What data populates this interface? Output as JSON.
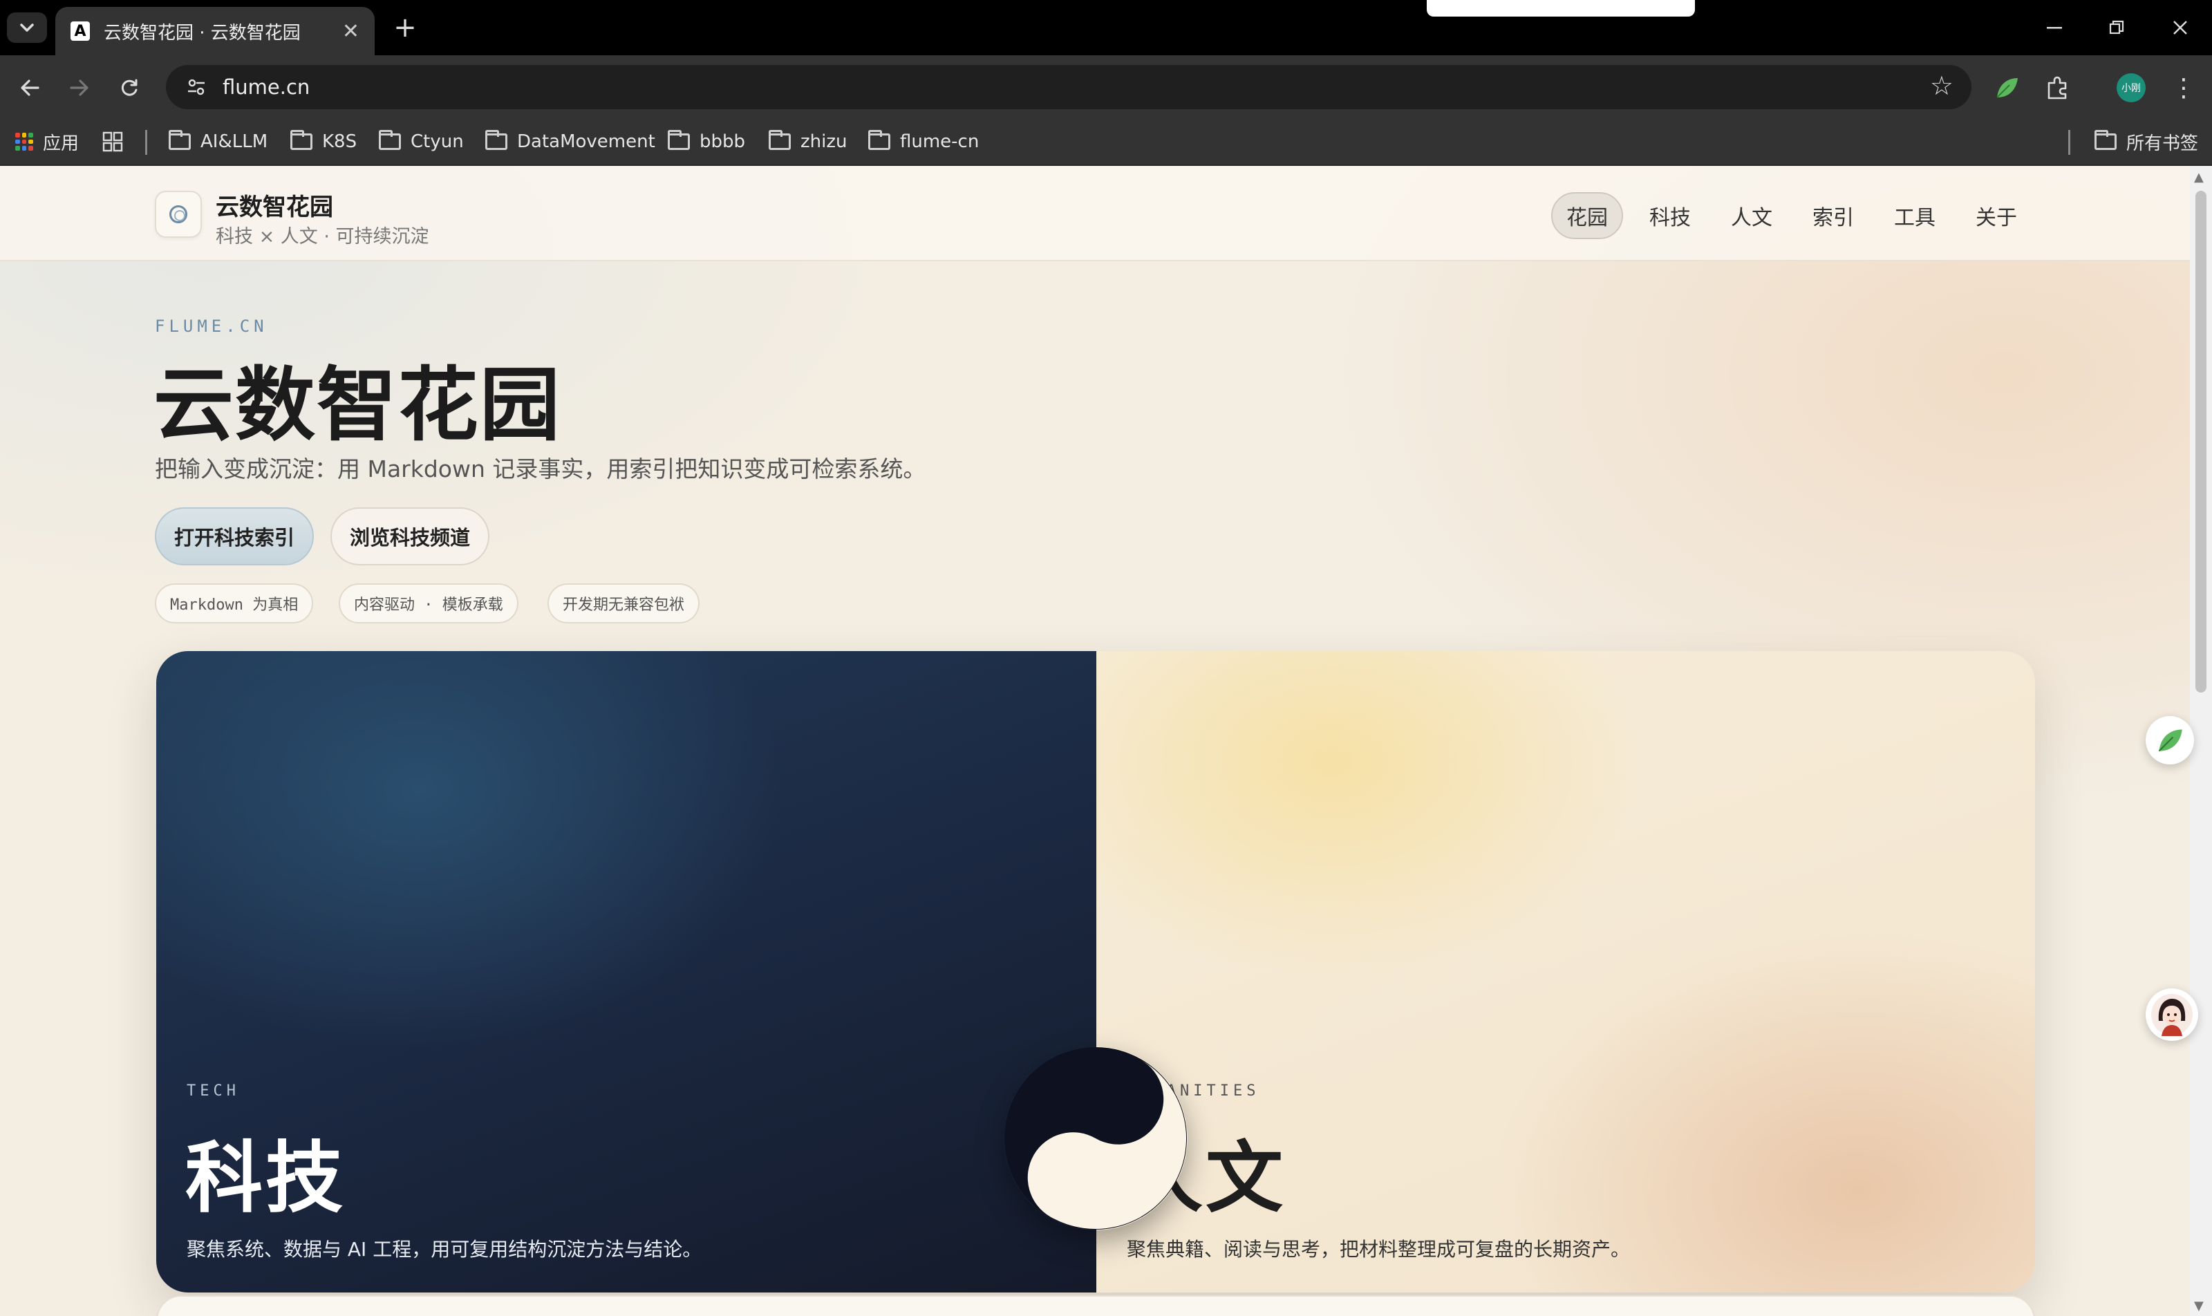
{
  "browser": {
    "tab_title": "云数智花园 · 云数智花园",
    "tab_favicon_letter": "A",
    "url": "flume.cn",
    "profile_label": "小刚",
    "bookmarks": {
      "apps_label": "应用",
      "folders": [
        "AI&LLM",
        "K8S",
        "Ctyun",
        "DataMovement",
        "bbbb",
        "zhizu",
        "flume-cn"
      ],
      "all_bookmarks_label": "所有书签"
    }
  },
  "site": {
    "name": "云数智花园",
    "tagline": "科技 × 人文 · 可持续沉淀",
    "nav": [
      {
        "label": "花园",
        "active": true
      },
      {
        "label": "科技",
        "active": false
      },
      {
        "label": "人文",
        "active": false
      },
      {
        "label": "索引",
        "active": false
      },
      {
        "label": "工具",
        "active": false
      },
      {
        "label": "关于",
        "active": false
      }
    ]
  },
  "hero": {
    "eyebrow": "FLUME.CN",
    "title": "云数智花园",
    "subtitle": "把输入变成沉淀：用 Markdown 记录事实，用索引把知识变成可检索系统。",
    "primary_button": "打开科技索引",
    "secondary_button": "浏览科技频道",
    "chips": [
      "Markdown 为真相",
      "内容驱动 · 模板承载",
      "开发期无兼容包袱"
    ]
  },
  "panels": {
    "tech": {
      "eyebrow": "TECH",
      "title": "科技",
      "description": "聚焦系统、数据与 AI 工程，用可复用结构沉淀方法与结论。"
    },
    "humanities": {
      "eyebrow": "HUMANITIES",
      "title": "人文",
      "description": "聚焦典籍、阅读与思考，把材料整理成可复盘的长期资产。"
    }
  },
  "icons": {
    "tab_list": "chevron-down-icon",
    "back": "arrow-left-icon",
    "forward": "arrow-right-icon",
    "reload": "reload-icon",
    "site_info": "tune-icon",
    "bookmark_star": "star-icon",
    "extension_leaf": "leaf-icon",
    "extensions": "puzzle-icon",
    "menu": "more-vertical-icon",
    "logo": "ring-icon",
    "divider": "yin-yang-icon"
  },
  "colors": {
    "accent_blue": "#6c8aa6",
    "tech_bg": "#1c2a44",
    "humanities_bg": "#f3e5cf",
    "leaf_green": "#5cb85c"
  }
}
